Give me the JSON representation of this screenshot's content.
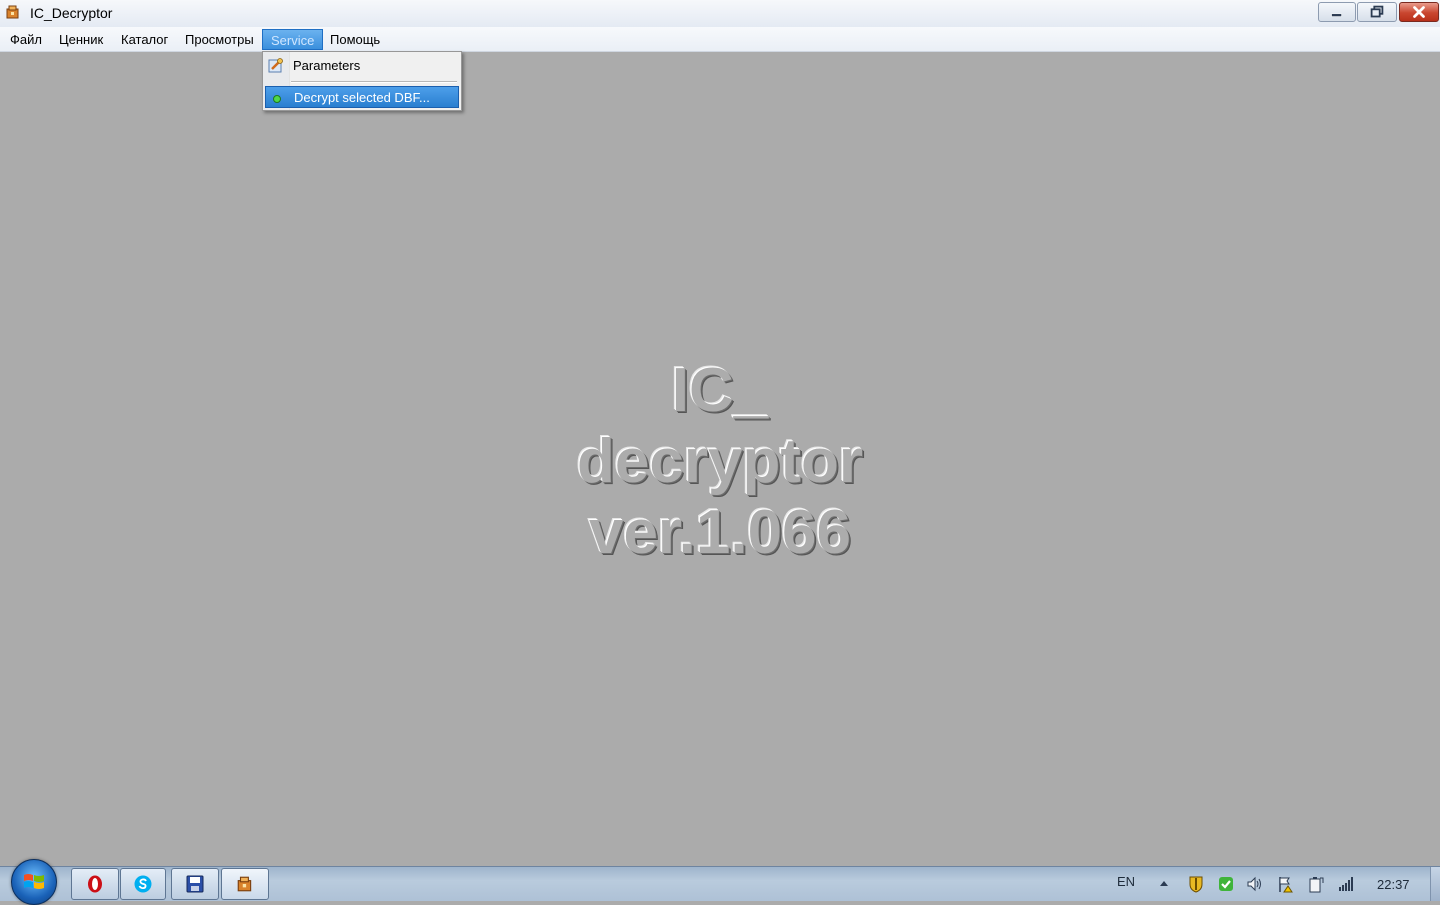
{
  "window": {
    "title": "IC_Decryptor"
  },
  "menubar": {
    "items": [
      {
        "label": "Файл"
      },
      {
        "label": "Ценник"
      },
      {
        "label": "Каталог"
      },
      {
        "label": "Просмотры"
      },
      {
        "label": "Service",
        "active": true
      },
      {
        "label": "Помощь"
      }
    ]
  },
  "service_menu": {
    "items": [
      {
        "label": "Parameters",
        "icon": "parameters-icon"
      },
      {
        "label": "Decrypt selected DBF...",
        "icon": "green-dot-icon",
        "selected": true
      }
    ]
  },
  "splash": {
    "line1": "IC_",
    "line2": "decryptor",
    "line3": "ver.1.066"
  },
  "taskbar": {
    "pinned": [
      {
        "name": "opera",
        "icon": "opera-icon"
      },
      {
        "name": "skype",
        "icon": "skype-icon"
      },
      {
        "name": "save-app",
        "icon": "floppy-disk-icon"
      },
      {
        "name": "ic-decryptor",
        "icon": "ic-decryptor-app-icon"
      }
    ],
    "tray": {
      "language": "EN",
      "time": "22:37"
    }
  },
  "colors": {
    "workspace": "#ababab",
    "menu_highlight": "#3a8fdd",
    "close_button": "#c9462f"
  }
}
